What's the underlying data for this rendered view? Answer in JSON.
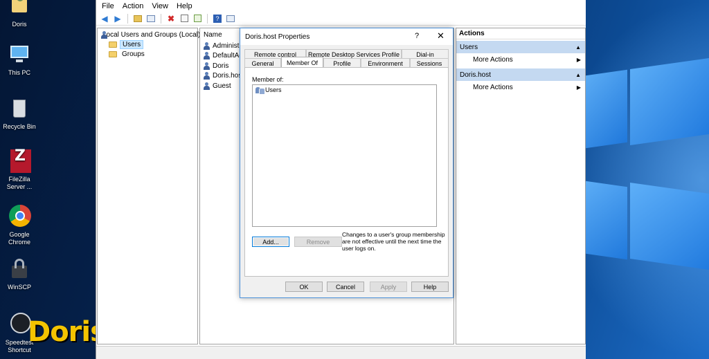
{
  "desktop": {
    "icons": [
      {
        "label": "Doris",
        "icon": "user-folder-icon"
      },
      {
        "label": "This PC",
        "icon": "computer-icon"
      },
      {
        "label": "Recycle Bin",
        "icon": "recycle-bin-icon"
      },
      {
        "label": "FileZilla Server ...",
        "icon": "filezilla-icon"
      },
      {
        "label": "Google Chrome",
        "icon": "chrome-icon"
      },
      {
        "label": "WinSCP",
        "icon": "winscp-icon"
      },
      {
        "label": "Speedtest Shortcut",
        "icon": "speedtest-icon"
      }
    ],
    "brand": "Doris"
  },
  "menu": {
    "file": "File",
    "action": "Action",
    "view": "View",
    "help": "Help"
  },
  "toolbar": {
    "icons": [
      "back-arrow-icon",
      "forward-arrow-icon",
      "up-folder-icon",
      "show-hide-tree-icon",
      "delete-icon",
      "properties-icon",
      "export-icon",
      "help-icon",
      "action-pane-icon"
    ]
  },
  "tree": {
    "root": "Local Users and Groups (Local)",
    "items": [
      "Users",
      "Groups"
    ],
    "selected": "Users"
  },
  "list": {
    "header": "Name",
    "rows": [
      "Administra",
      "DefaultAcc",
      "Doris",
      "Doris.host",
      "Guest"
    ]
  },
  "actions": {
    "title": "Actions",
    "sections": [
      {
        "name": "Users",
        "item": "More Actions"
      },
      {
        "name": "Doris.host",
        "item": "More Actions"
      }
    ]
  },
  "dialog": {
    "title": "Doris.host Properties",
    "help_glyph": "?",
    "close_glyph": "✕",
    "tabs_row1": [
      "Remote control",
      "Remote Desktop Services Profile",
      "Dial-in"
    ],
    "tabs_row2": [
      "General",
      "Member Of",
      "Profile",
      "Environment",
      "Sessions"
    ],
    "active_tab": "Member Of",
    "member_of_label": "Member of:",
    "members": [
      "Users"
    ],
    "add_button": "Add...",
    "remove_button": "Remove",
    "note": "Changes to a user's group membership are not effective until the next time the user logs on.",
    "ok": "OK",
    "cancel": "Cancel",
    "apply": "Apply",
    "help": "Help"
  },
  "colors": {
    "section_bg": "#c4d9f1",
    "selection_bg": "#cce8ff",
    "dialog_border": "#4a90d9",
    "brand_yellow": "#f4c400"
  }
}
